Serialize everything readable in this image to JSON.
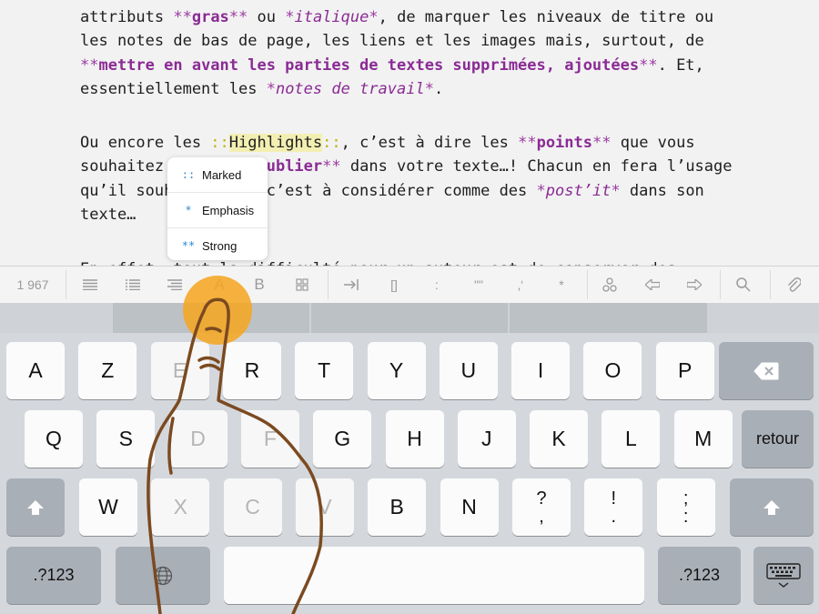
{
  "editor": {
    "lines": [
      [
        {
          "t": "attributs "
        },
        {
          "t": "**",
          "c": "mk"
        },
        {
          "t": "gras",
          "c": "b"
        },
        {
          "t": "**",
          "c": "mk"
        },
        {
          "t": " ou "
        },
        {
          "t": "*",
          "c": "mk"
        },
        {
          "t": "italique",
          "c": "i"
        },
        {
          "t": "*",
          "c": "mk"
        },
        {
          "t": ", de marquer les niveaux de titre ou"
        }
      ],
      [
        {
          "t": "les notes de bas de page, les liens et les images mais, surtout, de"
        }
      ],
      [
        {
          "t": "**",
          "c": "mk"
        },
        {
          "t": "mettre en avant les parties de textes supprimées, ajoutées",
          "c": "b"
        },
        {
          "t": "**",
          "c": "mk"
        },
        {
          "t": ". Et,"
        }
      ],
      [
        {
          "t": "essentiellement les "
        },
        {
          "t": "*",
          "c": "mk"
        },
        {
          "t": "notes de travail",
          "c": "i"
        },
        {
          "t": "*",
          "c": "mk"
        },
        {
          "t": "."
        }
      ],
      [],
      [
        {
          "t": "Ou encore les "
        },
        {
          "t": "::",
          "c": "hlmk"
        },
        {
          "t": "Highlights",
          "c": "hl"
        },
        {
          "t": "::",
          "c": "hlmk"
        },
        {
          "t": ", c’est à dire les "
        },
        {
          "t": "**",
          "c": "mk"
        },
        {
          "t": "points",
          "c": "b"
        },
        {
          "t": "**",
          "c": "mk"
        },
        {
          "t": " que vous"
        }
      ],
      [
        {
          "t": "souhaitez "
        },
        {
          "t": "**",
          "c": "mk"
        },
        {
          "t": "ne pas oublier",
          "c": "b"
        },
        {
          "t": "**",
          "c": "mk"
        },
        {
          "t": " dans votre texte…! Chacun en fera l’usage"
        }
      ],
      [
        {
          "t": "qu’il souhaite mais c’est à considérer comme des "
        },
        {
          "t": "*",
          "c": "mk"
        },
        {
          "t": "post’it",
          "c": "i"
        },
        {
          "t": "*",
          "c": "mk"
        },
        {
          "t": " dans son"
        }
      ],
      [
        {
          "t": "texte…"
        }
      ],
      [],
      [
        {
          "t": "En effet, tout la difficulté pour un auteur est de conserver des"
        }
      ]
    ]
  },
  "popup": {
    "items": [
      {
        "icon": "::",
        "label": "Marked"
      },
      {
        "icon": "*",
        "label": "Emphasis"
      },
      {
        "icon": "**",
        "label": "Strong"
      }
    ]
  },
  "toolbar": {
    "word_count": "1 967",
    "buttons": [
      "align-left-icon",
      "list-icon",
      "align-right-icon",
      "A",
      "B",
      "grid-icon",
      "indent-icon",
      "[]",
      ":",
      "\"\"",
      "‚‘",
      "*",
      "link-icon",
      "arrow-left-icon",
      "arrow-right-icon",
      "search-icon",
      "paperclip-icon"
    ]
  },
  "keyboard": {
    "row1": [
      "A",
      "Z",
      "E",
      "R",
      "T",
      "Y",
      "U",
      "I",
      "O",
      "P"
    ],
    "row2": [
      "Q",
      "S",
      "D",
      "F",
      "G",
      "H",
      "J",
      "K",
      "L",
      "M"
    ],
    "row3": [
      "W",
      "X",
      "C",
      "V",
      "B",
      "N"
    ],
    "row3_punct": [
      [
        "?",
        ","
      ],
      [
        "!",
        "."
      ],
      [
        ";",
        ":"
      ]
    ],
    "return_label": "retour",
    "numbers_label": ".?123"
  }
}
